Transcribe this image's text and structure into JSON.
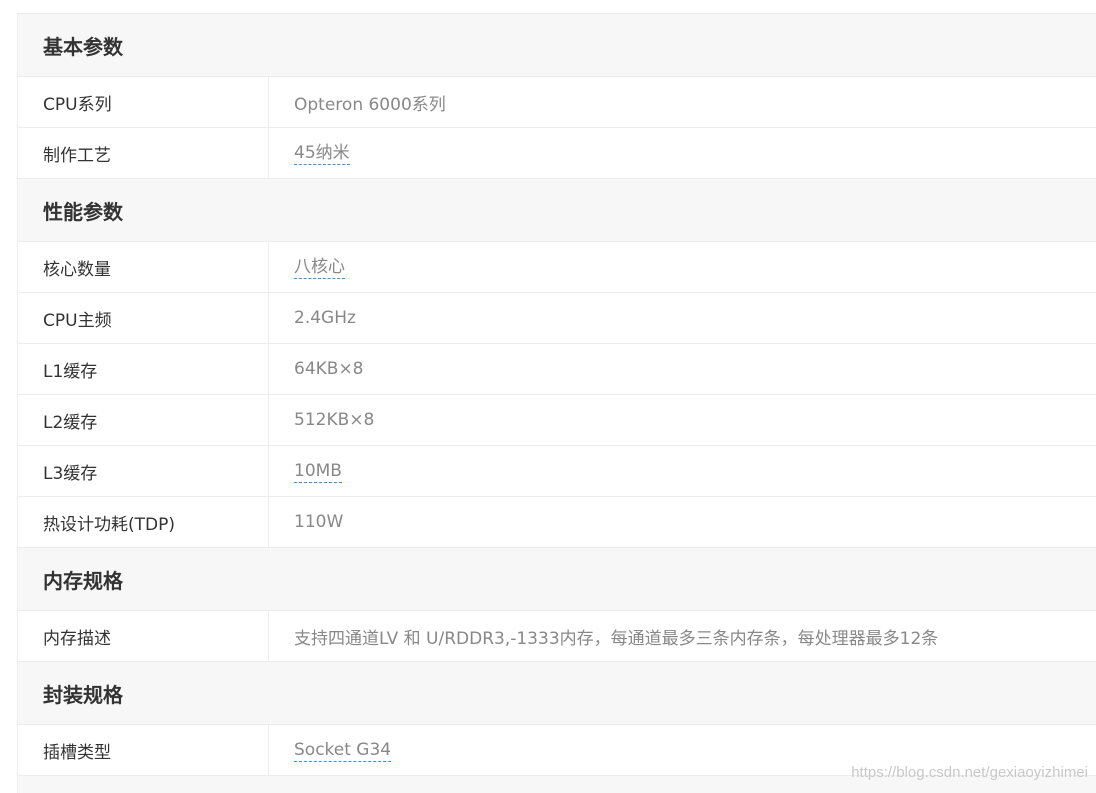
{
  "sections": [
    {
      "title": "基本参数",
      "rows": [
        {
          "label": "CPU系列",
          "value": "Opteron 6000系列",
          "link": false
        },
        {
          "label": "制作工艺",
          "value": "45纳米",
          "link": true
        }
      ]
    },
    {
      "title": "性能参数",
      "rows": [
        {
          "label": "核心数量",
          "value": "八核心",
          "link": true
        },
        {
          "label": "CPU主频",
          "value": "2.4GHz",
          "link": false
        },
        {
          "label": "L1缓存",
          "value": "64KB×8",
          "link": false
        },
        {
          "label": "L2缓存",
          "value": "512KB×8",
          "link": false
        },
        {
          "label": "L3缓存",
          "value": "10MB",
          "link": true
        },
        {
          "label": "热设计功耗(TDP)",
          "value": "110W",
          "link": false
        }
      ]
    },
    {
      "title": "内存规格",
      "rows": [
        {
          "label": "内存描述",
          "value": "支持四通道LV 和 U/RDDR3,-1333内存，每通道最多三条内存条，每处理器最多12条",
          "link": false
        }
      ]
    },
    {
      "title": "封装规格",
      "rows": [
        {
          "label": "插槽类型",
          "value": "Socket G34",
          "link": true
        }
      ]
    }
  ],
  "watermark": "https://blog.csdn.net/gexiaoyizhimei"
}
